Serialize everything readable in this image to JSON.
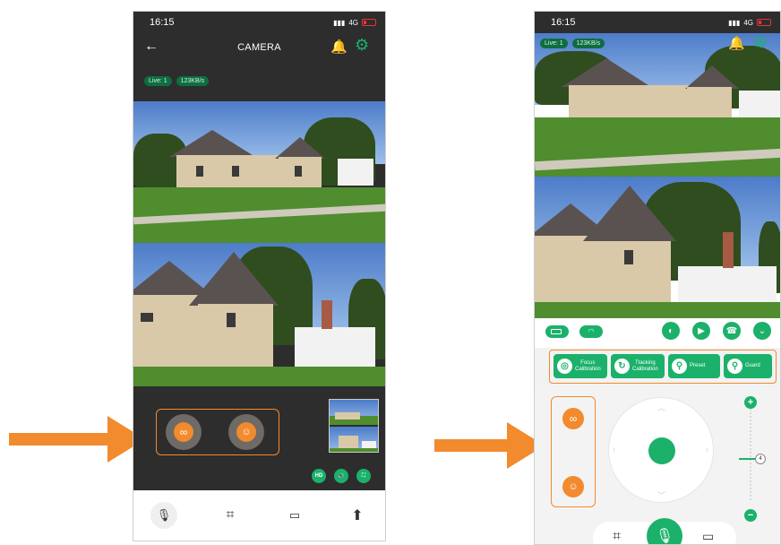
{
  "left": {
    "status": {
      "time": "16:15",
      "network": "4G"
    },
    "nav": {
      "title": "CAMERA",
      "back_icon": "arrow-left-icon"
    },
    "badges": {
      "live": "Live: 1",
      "speed": "123KB/s"
    },
    "controls": {
      "link_icon": "link-icon",
      "tracking_icon": "face-tracking-icon"
    },
    "overlay_buttons": {
      "hd": "HD"
    },
    "tabs": [
      {
        "name": "microphone-icon",
        "glyph": "🎙"
      },
      {
        "name": "crop-icon",
        "glyph": "⌗"
      },
      {
        "name": "video-record-icon",
        "glyph": "⏺"
      },
      {
        "name": "upload-icon",
        "glyph": "⬆"
      }
    ]
  },
  "right": {
    "status": {
      "time": "16:15",
      "network": "4G"
    },
    "badges": {
      "live": "Live: 1",
      "speed": "123KB/s"
    },
    "actions": [
      {
        "label_line1": "Focus",
        "label_line2": "Calibration"
      },
      {
        "label_line1": "Ttacking",
        "label_line2": "Calibration"
      },
      {
        "label_line1": "Preset",
        "label_line2": ""
      },
      {
        "label_line1": "Guard",
        "label_line2": ""
      }
    ],
    "zoom_level": "4"
  },
  "colors": {
    "accent": "#1bb16a",
    "highlight": "#f28a2e",
    "dark": "#2d2d2d"
  }
}
